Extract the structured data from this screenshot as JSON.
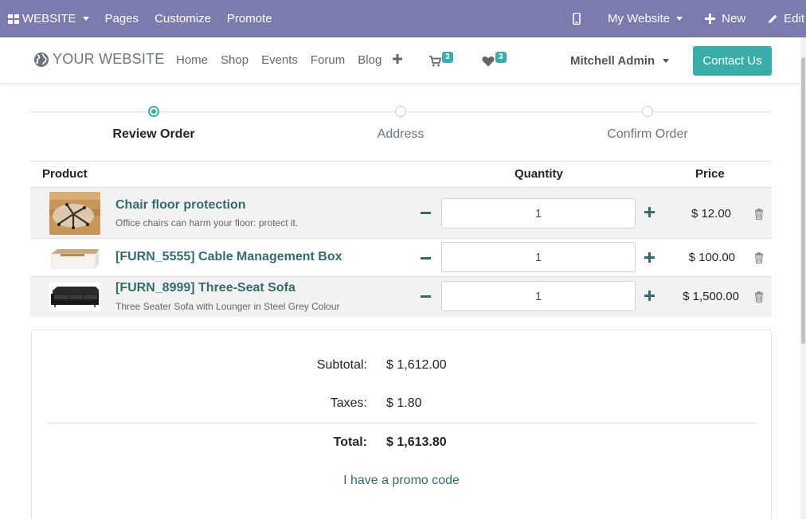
{
  "adminbar": {
    "website_label": "WEBSITE",
    "pages_label": "Pages",
    "customize_label": "Customize",
    "promote_label": "Promote",
    "my_website_label": "My Website",
    "new_label": "New",
    "edit_label": "Edit",
    "background": "#7c7bad"
  },
  "navbar": {
    "logo_text": "YOUR WEBSITE",
    "links": [
      "Home",
      "Shop",
      "Events",
      "Forum",
      "Blog"
    ],
    "cart_count": "3",
    "wishlist_count": "3",
    "user_name": "Mitchell Admin",
    "contact_label": "Contact Us",
    "accent": "#3aadaa"
  },
  "steps": [
    {
      "label": "Review Order",
      "active": true
    },
    {
      "label": "Address",
      "active": false
    },
    {
      "label": "Confirm Order",
      "active": false
    }
  ],
  "table": {
    "headers": {
      "product": "Product",
      "quantity": "Quantity",
      "price": "Price"
    },
    "rows": [
      {
        "name": "Chair floor protection",
        "description": "Office chairs can harm your floor: protect it.",
        "quantity": "1",
        "price": "$ 12.00",
        "image": "chair-floor-mat"
      },
      {
        "name": "[FURN_5555] Cable Management Box",
        "description": "",
        "quantity": "1",
        "price": "$ 100.00",
        "image": "cable-box"
      },
      {
        "name": "[FURN_8999] Three-Seat Sofa",
        "description": "Three Seater Sofa with Lounger in Steel Grey Colour",
        "quantity": "1",
        "price": "$ 1,500.00",
        "image": "black-sofa"
      }
    ]
  },
  "summary": {
    "subtotal_label": "Subtotal:",
    "subtotal_value": "$ 1,612.00",
    "taxes_label": "Taxes:",
    "taxes_value": "$ 1.80",
    "total_label": "Total:",
    "total_value": "$ 1,613.80",
    "promo_label": "I have a promo code"
  }
}
